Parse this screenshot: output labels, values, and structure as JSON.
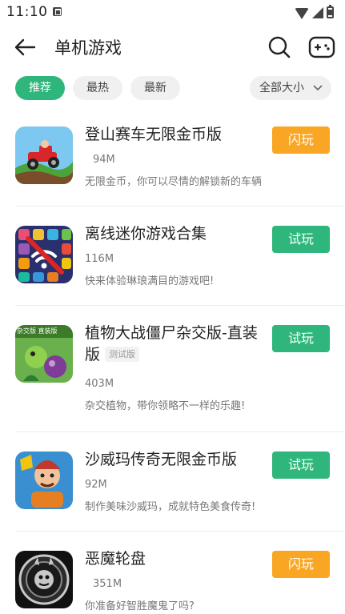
{
  "status_bar": {
    "time": "11:10"
  },
  "app_bar": {
    "title": "单机游戏"
  },
  "filters": {
    "tabs": [
      {
        "label": "推荐",
        "active": true
      },
      {
        "label": "最热",
        "active": false
      },
      {
        "label": "最新",
        "active": false
      }
    ],
    "sort_label": "全部大小"
  },
  "games": [
    {
      "name": "登山赛车无限金币版",
      "size": "94M",
      "desc": "无限金币，你可以尽情的解锁新的车辆",
      "button": "闪玩",
      "button_type": "flash",
      "tag": "",
      "icon": "hill-climb-racing-icon"
    },
    {
      "name": "离线迷你游戏合集",
      "size": "116M",
      "desc": "快来体验琳琅满目的游戏吧!",
      "button": "试玩",
      "button_type": "try",
      "tag": "",
      "icon": "offline-mini-games-icon"
    },
    {
      "name": "植物大战僵尸杂交版-直装版",
      "name_line1": "植物大战僵尸杂交版-直装",
      "name_line2": "版",
      "size": "403M",
      "desc": "杂交植物，带你领略不一样的乐趣!",
      "button": "试玩",
      "button_type": "try",
      "tag": "测试版",
      "icon": "pvz-hybrid-icon",
      "icon_badge": "杂交版 直装版"
    },
    {
      "name": "沙威玛传奇无限金币版",
      "size": "92M",
      "desc": "制作美味沙威玛，成就特色美食传奇!",
      "button": "试玩",
      "button_type": "try",
      "tag": "",
      "icon": "shawarma-legend-icon"
    },
    {
      "name": "恶魔轮盘",
      "size": "351M",
      "desc": "你准备好智胜魔鬼了吗?",
      "button": "闪玩",
      "button_type": "flash",
      "tag": "",
      "icon": "devil-roulette-icon"
    }
  ],
  "colors": {
    "accent_green": "#2fb67c",
    "accent_orange": "#f8a623"
  }
}
